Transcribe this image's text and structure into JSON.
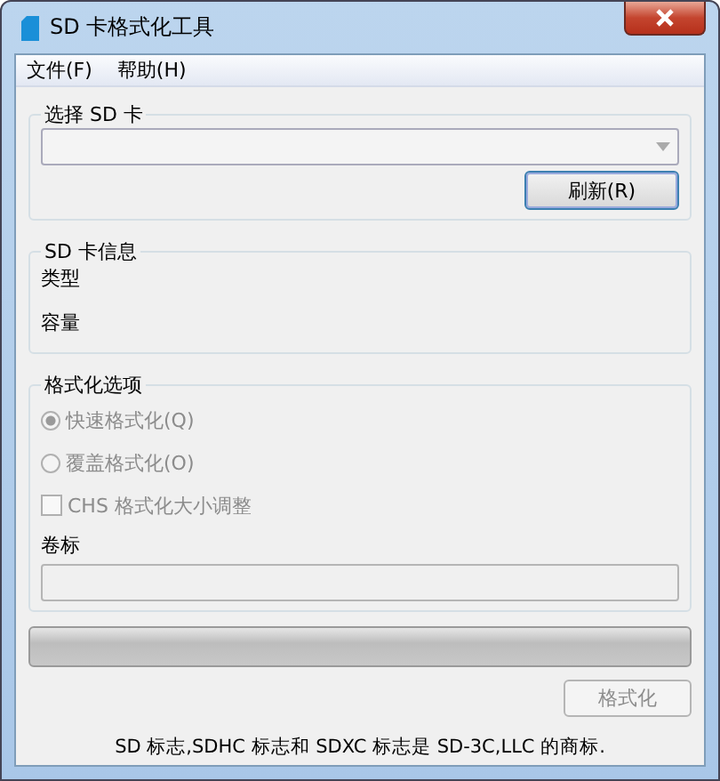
{
  "window": {
    "title": "SD 卡格式化工具"
  },
  "menu": [
    {
      "label": "文件(F)"
    },
    {
      "label": "帮助(H)"
    }
  ],
  "select_card": {
    "title": "选择 SD 卡",
    "refresh_button": "刷新(R)"
  },
  "card_info": {
    "title": "SD 卡信息",
    "fields": [
      "类型",
      "容量"
    ]
  },
  "format_options": {
    "title": "格式化选项",
    "disabled": true,
    "radios": [
      {
        "label": "快速格式化(Q)",
        "selected": true
      },
      {
        "label": "覆盖格式化(O)",
        "selected": false
      }
    ],
    "checkbox": {
      "label": "CHS 格式化大小调整",
      "checked": false
    },
    "volume_label": "卷标"
  },
  "progress": {
    "level": 0
  },
  "format_button": {
    "label": "格式化",
    "disabled": true
  },
  "footer": "SD 标志,SDHC 标志和 SDXC 标志是 SD-3C,LLC 的商标."
}
